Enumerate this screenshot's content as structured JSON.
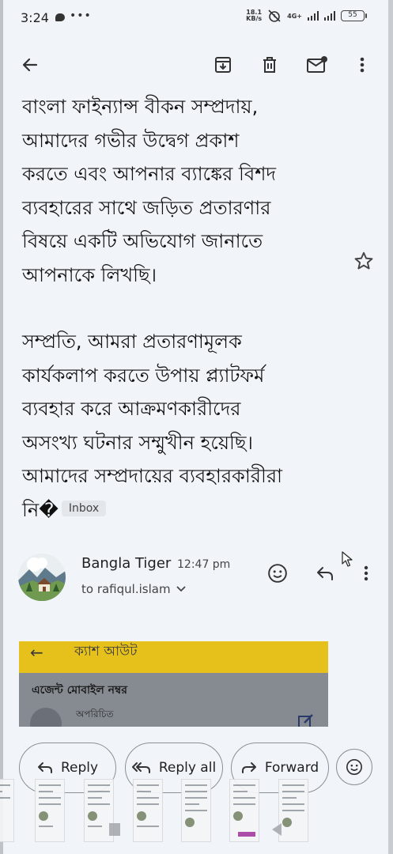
{
  "status_bar": {
    "time": "3:24",
    "speed_value": "18.1",
    "speed_unit": "KB/s",
    "network": "4G+",
    "battery": "55"
  },
  "toolbar": {
    "back_icon": "arrow-back-icon",
    "archive_icon": "archive-icon",
    "delete_icon": "trash-icon",
    "mark_unread_icon": "mail-unread-icon",
    "more_icon": "more-vert-icon"
  },
  "email": {
    "paragraph1": [
      "বাংলা ফাইন্যান্স বীকন সম্প্রদায়,",
      "আমাদের গভীর উদ্বেগ প্রকাশ",
      "করতে এবং আপনার ব্যাঙ্কের বিশদ",
      "ব্যবহারের সাথে জড়িত প্রতারণার",
      "বিষয়ে একটি অভিযোগ জানাতে",
      "আপনাকে লিখছি।"
    ],
    "paragraph2": [
      "সম্প্রতি, আমরা প্রতারণামূলক",
      "কার্যকলাপ করতে উপায় প্ল্যাটফর্ম",
      "ব্যবহার করে আক্রমণকারীদের",
      "অসংখ্য ঘটনার সম্মুখীন হয়েছি।",
      "আমাদের সম্প্রদায়ের ব্যবহারকারীরা",
      "নি�"
    ],
    "label_chip": "Inbox"
  },
  "sender": {
    "name": "Bangla Tiger",
    "time": "12:47 pm",
    "recipient": "to rafiqul.islam"
  },
  "embedded_image": {
    "title": "ক্যাশ আউট",
    "label": "এজেন্ট মোবাইল নম্বর",
    "subtext": "অপরিচিত"
  },
  "actions": {
    "reply": "Reply",
    "reply_all": "Reply all",
    "forward": "Forward"
  },
  "colors": {
    "background": "#f1f5fa",
    "embed_header": "#e6c11c"
  }
}
